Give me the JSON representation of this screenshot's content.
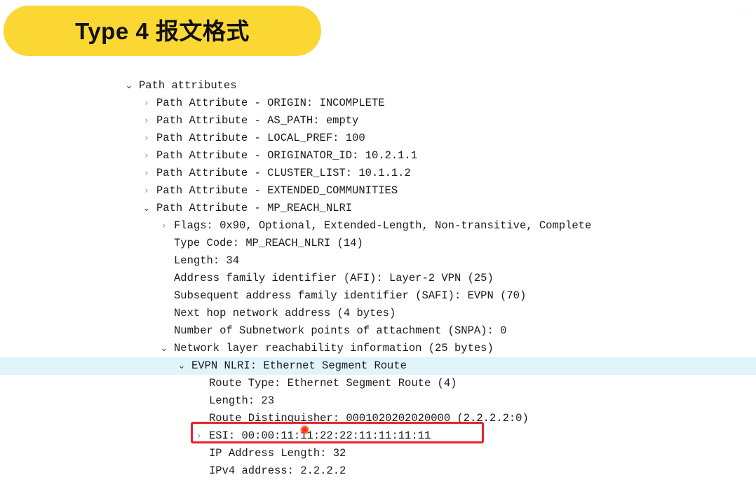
{
  "banner": {
    "title": "Type 4 报文格式",
    "background_color": "#FBD734",
    "text_color": "#111111"
  },
  "watermark": {
    "text": "技术"
  },
  "annotation": {
    "box_color": "#E8222A",
    "target_row_label": "ESI: 00:00:11:11:22:22:11:11:11:11",
    "cursor_color": "#FF2D13"
  },
  "highlight_color": "#E0F5FB",
  "icons": {
    "collapsed": "›",
    "expanded": "⌄"
  },
  "tree": {
    "rows": [
      {
        "indent": 0,
        "twisty": "expanded",
        "label": "Path attributes",
        "highlighted": false
      },
      {
        "indent": 1,
        "twisty": "collapsed",
        "label": "Path Attribute - ORIGIN: INCOMPLETE",
        "highlighted": false
      },
      {
        "indent": 1,
        "twisty": "collapsed",
        "label": "Path Attribute - AS_PATH: empty",
        "highlighted": false
      },
      {
        "indent": 1,
        "twisty": "collapsed",
        "label": "Path Attribute - LOCAL_PREF: 100",
        "highlighted": false
      },
      {
        "indent": 1,
        "twisty": "collapsed",
        "label": "Path Attribute - ORIGINATOR_ID: 10.2.1.1",
        "highlighted": false
      },
      {
        "indent": 1,
        "twisty": "collapsed",
        "label": "Path Attribute - CLUSTER_LIST: 10.1.1.2",
        "highlighted": false
      },
      {
        "indent": 1,
        "twisty": "collapsed",
        "label": "Path Attribute - EXTENDED_COMMUNITIES",
        "highlighted": false
      },
      {
        "indent": 1,
        "twisty": "expanded",
        "label": "Path Attribute - MP_REACH_NLRI",
        "highlighted": false
      },
      {
        "indent": 2,
        "twisty": "collapsed",
        "label": "Flags: 0x90, Optional, Extended-Length, Non-transitive, Complete",
        "highlighted": false
      },
      {
        "indent": 2,
        "twisty": "none",
        "label": "Type Code: MP_REACH_NLRI (14)",
        "highlighted": false
      },
      {
        "indent": 2,
        "twisty": "none",
        "label": "Length: 34",
        "highlighted": false
      },
      {
        "indent": 2,
        "twisty": "none",
        "label": "Address family identifier (AFI): Layer-2 VPN (25)",
        "highlighted": false
      },
      {
        "indent": 2,
        "twisty": "none",
        "label": "Subsequent address family identifier (SAFI): EVPN (70)",
        "highlighted": false
      },
      {
        "indent": 2,
        "twisty": "none",
        "label": "Next hop network address (4 bytes)",
        "highlighted": false
      },
      {
        "indent": 2,
        "twisty": "none",
        "label": "Number of Subnetwork points of attachment (SNPA): 0",
        "highlighted": false
      },
      {
        "indent": 2,
        "twisty": "expanded",
        "label": "Network layer reachability information (25 bytes)",
        "highlighted": false
      },
      {
        "indent": 3,
        "twisty": "expanded",
        "label": "EVPN NLRI: Ethernet Segment Route",
        "highlighted": true
      },
      {
        "indent": 4,
        "twisty": "none",
        "label": "Route Type: Ethernet Segment Route (4)",
        "highlighted": false
      },
      {
        "indent": 4,
        "twisty": "none",
        "label": "Length: 23",
        "highlighted": false
      },
      {
        "indent": 4,
        "twisty": "none",
        "label": "Route Distinguisher: 0001020202020000 (2.2.2.2:0)",
        "highlighted": false
      },
      {
        "indent": 4,
        "twisty": "collapsed",
        "label": "ESI: 00:00:11:11:22:22:11:11:11:11",
        "highlighted": false
      },
      {
        "indent": 4,
        "twisty": "none",
        "label": "IP Address Length: 32",
        "highlighted": false
      },
      {
        "indent": 4,
        "twisty": "none",
        "label": "IPv4 address: 2.2.2.2",
        "highlighted": false
      }
    ]
  }
}
